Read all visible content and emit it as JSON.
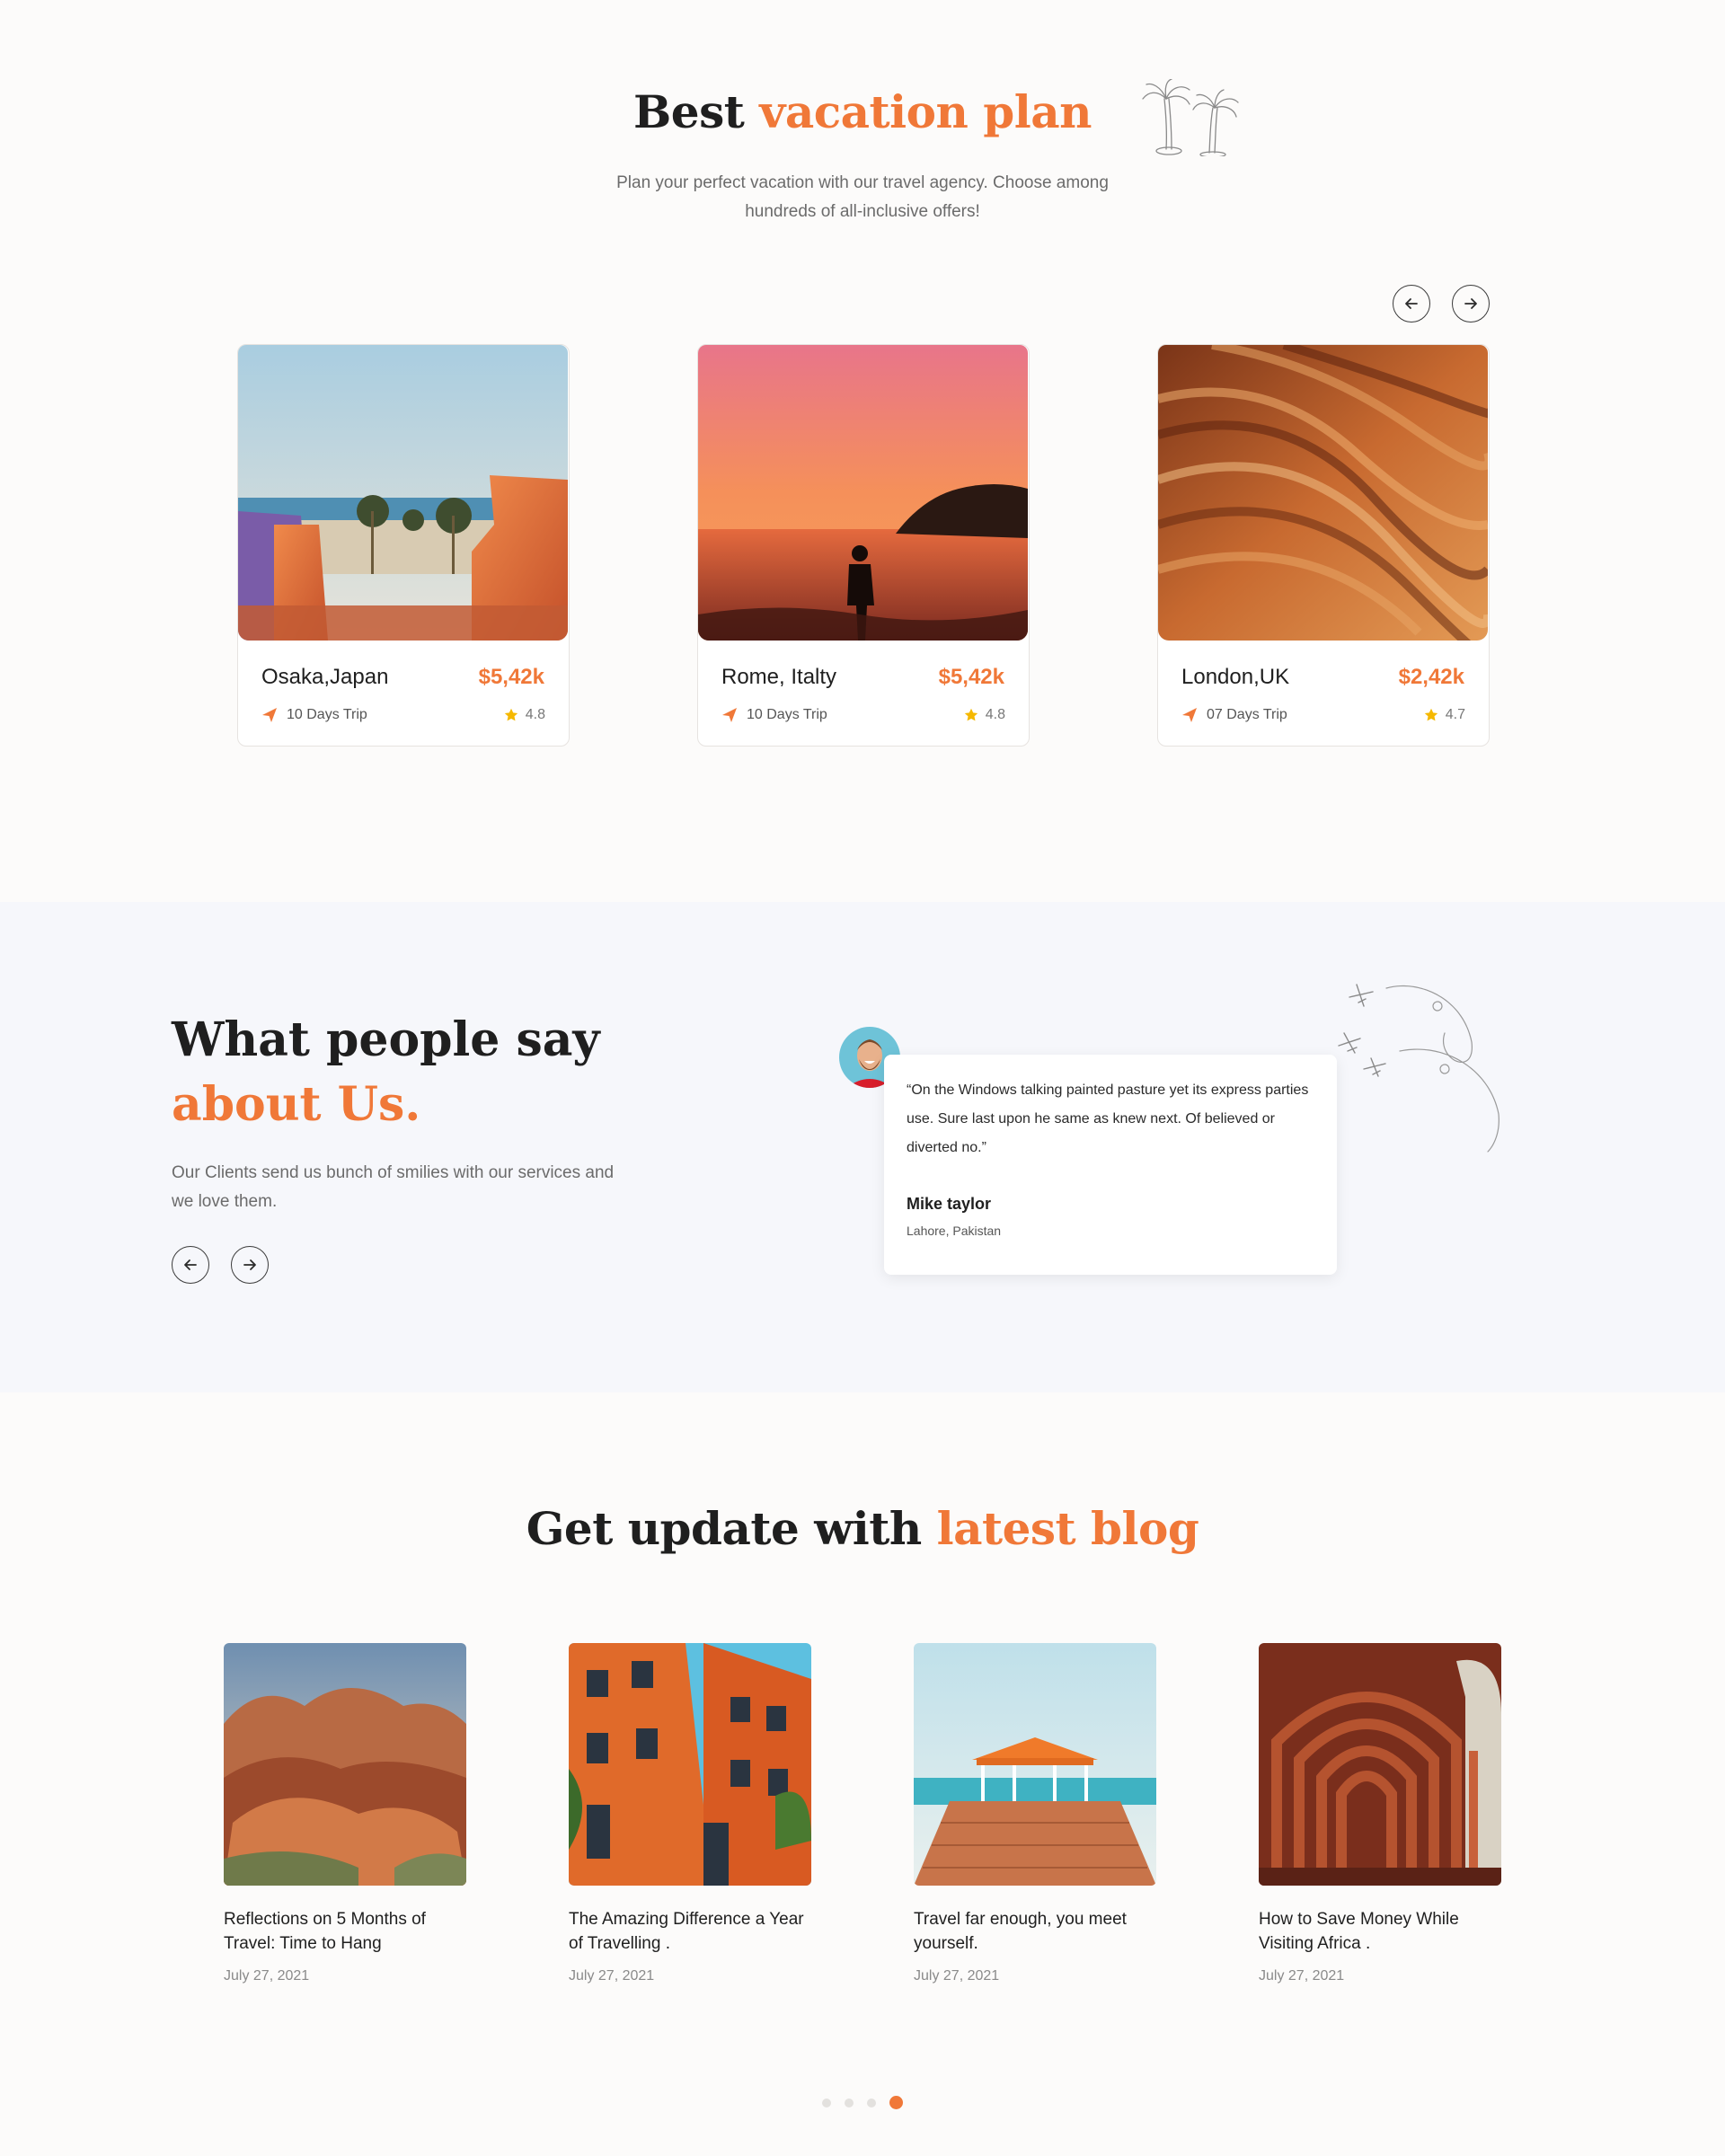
{
  "vacation": {
    "title_part1": "Best ",
    "title_accent": "vacation plan",
    "subtitle": "Plan your perfect vacation with our travel agency. Choose among hundreds of all-inclusive offers!",
    "cards": [
      {
        "city": "Osaka,Japan",
        "price": "$5,42k",
        "trip": "10 Days Trip",
        "rating": "4.8"
      },
      {
        "city": "Rome, Italty",
        "price": "$5,42k",
        "trip": "10 Days Trip",
        "rating": "4.8"
      },
      {
        "city": "London,UK",
        "price": "$2,42k",
        "trip": "07 Days Trip",
        "rating": "4.7"
      }
    ]
  },
  "testimonials": {
    "title_line1": "What people say",
    "title_line2": "about Us.",
    "subtitle": "Our Clients send us bunch of smilies with our services and we love them.",
    "quote": "“On the Windows talking painted pasture yet its express parties use. Sure last upon he same as knew next. Of believed or diverted no.”",
    "author": "Mike taylor",
    "location": "Lahore, Pakistan"
  },
  "blog": {
    "title_part1": "Get update with ",
    "title_accent": "latest blog",
    "posts": [
      {
        "title": "Reflections on 5 Months of Travel: Time to Hang",
        "date": "July 27, 2021"
      },
      {
        "title": "The Amazing Difference a Year of Travelling .",
        "date": "July 27, 2021"
      },
      {
        "title": "Travel far enough, you meet yourself.",
        "date": "July 27, 2021"
      },
      {
        "title": "How to Save Money While Visiting Africa .",
        "date": "July 27, 2021"
      }
    ],
    "pagination": {
      "total": 4,
      "active": 4
    }
  },
  "colors": {
    "accent": "#f07838",
    "star": "#f5b800",
    "testimonial_bg": "#f6f7fb"
  },
  "icons": [
    "arrow-left-icon",
    "arrow-right-icon",
    "paper-plane-icon",
    "star-icon",
    "palm-trees-icon",
    "airplane-path-icon"
  ]
}
